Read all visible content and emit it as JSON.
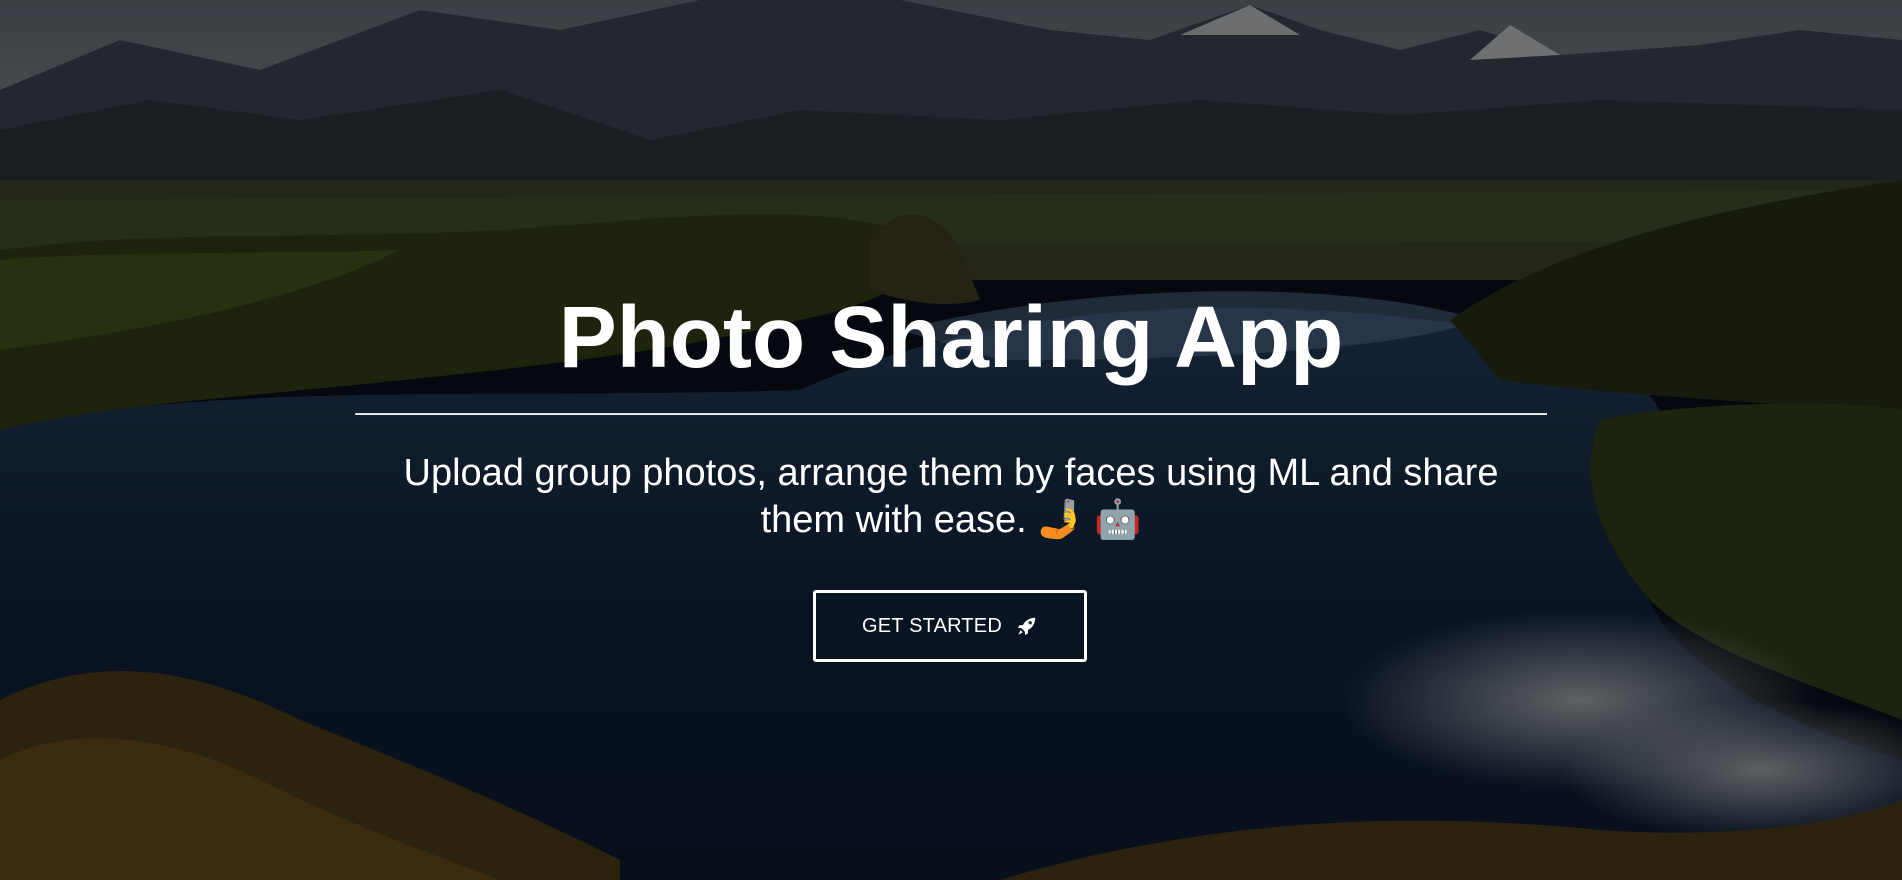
{
  "hero": {
    "title": "Photo Sharing App",
    "subtitle": "Upload group photos, arrange them by faces using ML and share them with ease.",
    "emojis": [
      "🤳",
      "🤖"
    ],
    "emoji_icons": [
      "selfie-icon",
      "robot-icon"
    ],
    "cta_label": "GET STARTED",
    "cta_icon": "rocket-icon",
    "background": "lake-and-mountains-landscape"
  },
  "colors": {
    "text": "#ffffff",
    "overlay": "rgba(0,0,0,0.52)",
    "button_border": "#ffffff"
  }
}
